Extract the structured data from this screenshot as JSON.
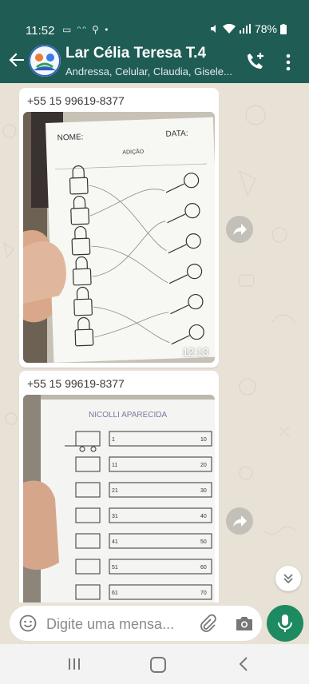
{
  "status_bar": {
    "time": "11:52",
    "left_icons": "▭ ᵔᵔ ⚲ •",
    "right_text": "78%"
  },
  "header": {
    "title": "Lar Célia Teresa T.4",
    "subtitle": "Andressa, Celular, Claudia, Gisele..."
  },
  "messages": [
    {
      "sender": "+55 15 99619-8377",
      "time": "12:13",
      "content": "photo-worksheet-addition"
    },
    {
      "sender": "+55 15 99619-8377",
      "time": "",
      "content": "photo-worksheet-train"
    }
  ],
  "composer": {
    "placeholder": "Digite uma mensa..."
  },
  "colors": {
    "header_bg": "#1f5c54",
    "chat_bg": "#e8e2d6",
    "mic_green": "#1e8a62"
  }
}
